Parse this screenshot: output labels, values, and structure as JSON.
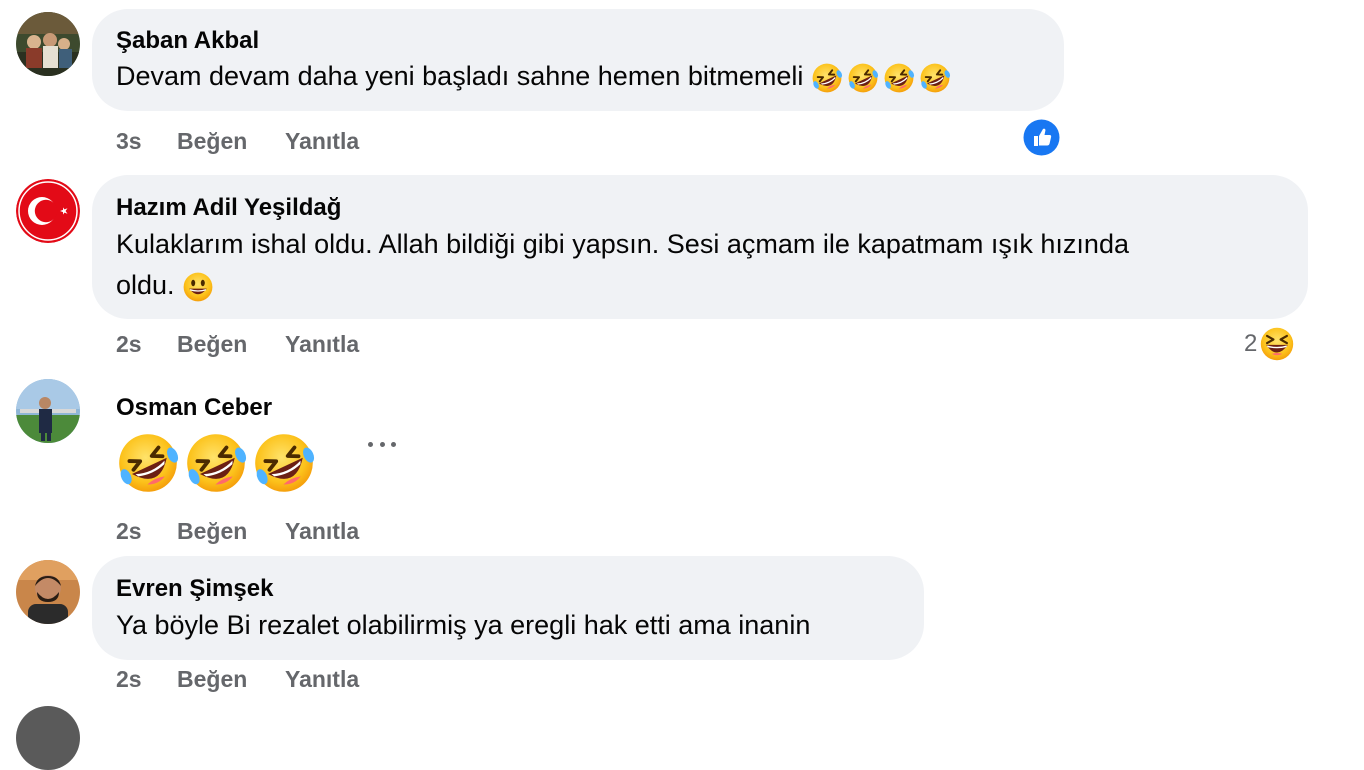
{
  "comments": [
    {
      "author": "Şaban Akbal",
      "text": "Devam devam daha yeni başladı sahne hemen bitmemeli",
      "time": "3s",
      "like": "Beğen",
      "reply": "Yanıtla",
      "reaction": "like-icon"
    },
    {
      "author": "Hazım Adil Yeşildağ",
      "text_line1": "Kulaklarım ishal oldu. Allah bildiği gibi yapsın. Sesi açmam ile kapatmam ışık hızında",
      "text_line2": "oldu.",
      "time": "2s",
      "like": "Beğen",
      "reply": "Yanıtla",
      "reaction_count": "2",
      "reaction": "grinning-squinting-emoji"
    },
    {
      "author": "Osman Ceber",
      "time": "2s",
      "like": "Beğen",
      "reply": "Yanıtla"
    },
    {
      "author": "Evren Şimşek",
      "text": "Ya böyle Bi rezalet olabilirmiş ya eregli hak etti ama inanin",
      "time": "2s",
      "like": "Beğen",
      "reply": "Yanıtla"
    }
  ],
  "colors": {
    "bubble": "#f0f2f5",
    "meta": "#65676b",
    "like_blue": "#1877f2"
  }
}
